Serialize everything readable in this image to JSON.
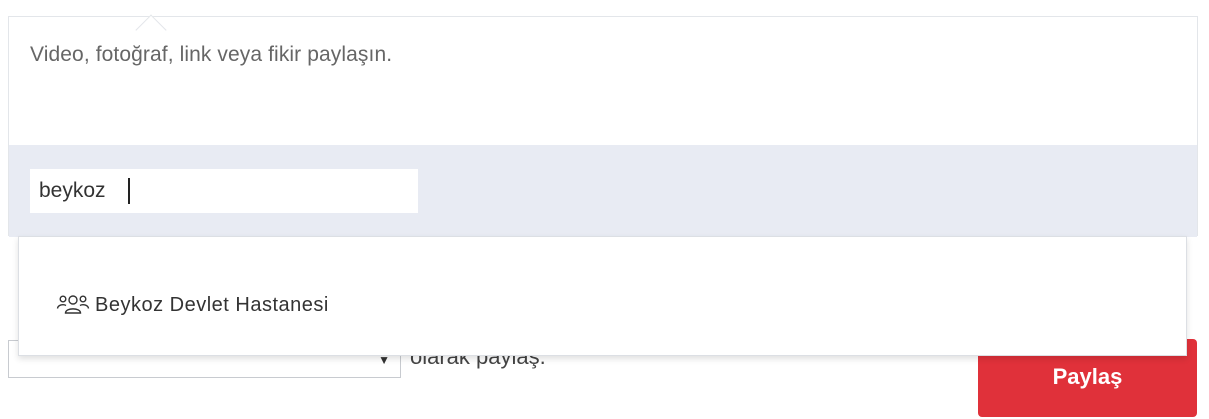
{
  "composer": {
    "placeholder": "Video, fotoğraf, link veya fikir paylaşın."
  },
  "tag_search": {
    "value": "beykoz"
  },
  "suggestions": [
    {
      "icon": "group-icon",
      "label": "Beykoz Devlet Hastanesi"
    }
  ],
  "share_as": {
    "selected": "",
    "suffix": "olarak paylaş."
  },
  "share_button": {
    "label": "Paylaş"
  },
  "colors": {
    "accent": "#e0313a",
    "tag_bar_bg": "#e8ebf3"
  }
}
